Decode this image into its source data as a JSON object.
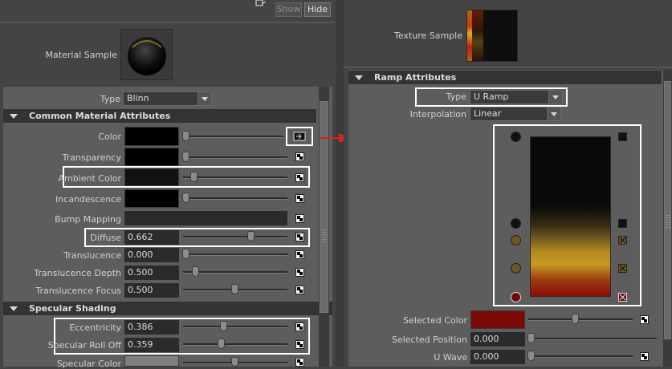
{
  "toolbar": {
    "show_label": "Show",
    "hide_label": "Hide"
  },
  "left": {
    "material_sample_label": "Material Sample",
    "type_label": "Type",
    "type_value": "Blinn",
    "common_header": "Common Material Attributes",
    "rows": {
      "color": {
        "label": "Color",
        "slider": 0.0
      },
      "transparency": {
        "label": "Transparency",
        "slider": 0.0
      },
      "ambient": {
        "label": "Ambient Color",
        "slider": 0.1
      },
      "incandescence": {
        "label": "Incandescence",
        "slider": 0.0
      },
      "bump": {
        "label": "Bump Mapping"
      },
      "diffuse": {
        "label": "Diffuse",
        "value": "0.662",
        "slider": 0.662
      },
      "translucence": {
        "label": "Translucence",
        "value": "0.000",
        "slider": 0.0
      },
      "translucence_depth": {
        "label": "Translucence Depth",
        "value": "0.500",
        "slider": 0.1
      },
      "translucence_focus": {
        "label": "Translucence Focus",
        "value": "0.500",
        "slider": 0.5
      }
    },
    "specular_header": "Specular Shading",
    "specular": {
      "eccentricity": {
        "label": "Eccentricity",
        "value": "0.386",
        "slider": 0.386
      },
      "rolloff": {
        "label": "Specular Roll Off",
        "value": "0.359",
        "slider": 0.359
      },
      "spec_color": {
        "label": "Specular Color",
        "slider": 0.5
      }
    }
  },
  "right": {
    "texture_sample_label": "Texture Sample",
    "ramp_header": "Ramp Attributes",
    "type_label": "Type",
    "type_value": "U Ramp",
    "interp_label": "Interpolation",
    "interp_value": "Linear",
    "selected_color_label": "Selected Color",
    "selected_color_hex": "#7a0a08",
    "selected_position_label": "Selected Position",
    "selected_position_value": "0.000",
    "u_wave_label": "U Wave",
    "u_wave_value": "0.000"
  },
  "colors": {
    "highlight": "#ffffff",
    "arrow": "#e02020",
    "ramp_handle_dark": "#111111",
    "ramp_handle_gold": "#6b5520",
    "ramp_handle_red": "#6a0a0a"
  }
}
